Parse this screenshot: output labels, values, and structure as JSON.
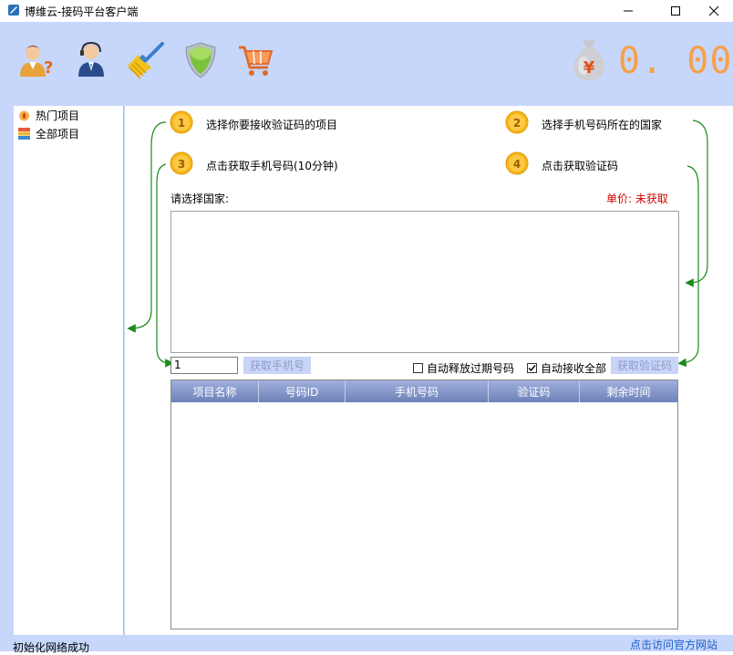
{
  "window": {
    "title": "博维云-接码平台客户端"
  },
  "toolbar": {
    "icons": [
      "user-help-icon",
      "customer-service-icon",
      "broom-clean-icon",
      "shield-icon",
      "shopping-cart-icon"
    ],
    "balance": "0. 00",
    "currency_symbol": "¥"
  },
  "sidebar": {
    "items": [
      {
        "label": "热门项目",
        "icon": "fire-icon"
      },
      {
        "label": "全部项目",
        "icon": "stack-icon"
      }
    ]
  },
  "steps": [
    {
      "num": "1",
      "text": "选择你要接收验证码的项目"
    },
    {
      "num": "2",
      "text": "选择手机号码所在的国家"
    },
    {
      "num": "3",
      "text": "点击获取手机号码(10分钟)"
    },
    {
      "num": "4",
      "text": "点击获取验证码"
    }
  ],
  "country": {
    "label": "请选择国家:",
    "price_label": "单价: 未获取"
  },
  "controls": {
    "quantity": "1",
    "get_phone_button": "获取手机号",
    "auto_release_label": "自动释放过期号码",
    "auto_release_checked": false,
    "auto_receive_label": "自动接收全部",
    "auto_receive_checked": true,
    "get_code_button": "获取验证码"
  },
  "table": {
    "columns": [
      "项目名称",
      "号码ID",
      "手机号码",
      "验证码",
      "剩余时间"
    ],
    "rows": []
  },
  "status": {
    "left": "初始化网络成功",
    "right_link": "点击访问官方网站"
  },
  "colors": {
    "toolbar_bg": "#c7d6fb",
    "balance": "#f5a14a",
    "price": "#d40000",
    "link": "#1c5fc9",
    "arrow": "#1a8a1a"
  }
}
